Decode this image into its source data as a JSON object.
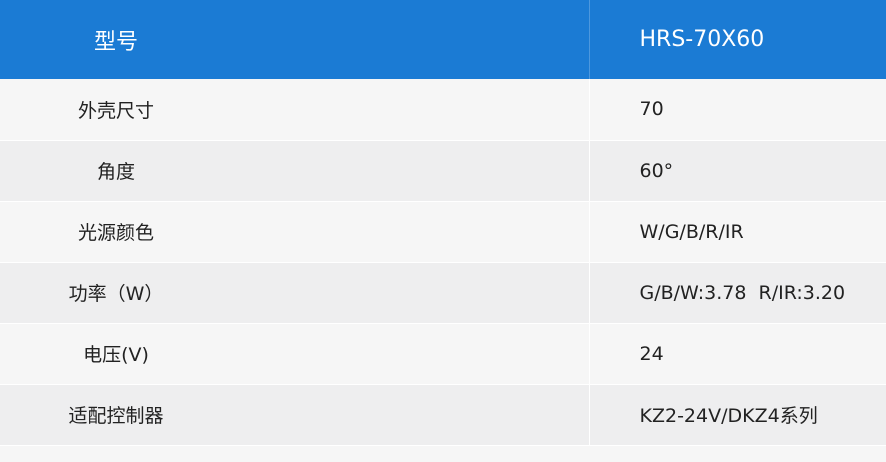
{
  "header": {
    "model_label": "型号",
    "model_value": "HRS-70X60"
  },
  "rows": [
    {
      "label": "外壳尺寸",
      "value": "70"
    },
    {
      "label": "角度",
      "value": "60°"
    },
    {
      "label": "光源颜色",
      "value": "W/G/B/R/IR"
    },
    {
      "label": "功率（W）",
      "value": "G/B/W:3.78  R/IR:3.20"
    },
    {
      "label": "电压(V)",
      "value": "24"
    },
    {
      "label": "适配控制器",
      "value": "KZ2-24V/DKZ4系列"
    }
  ],
  "colors": {
    "header_bg": "#1b7bd4",
    "row_light": "#f6f6f6",
    "row_dark": "#eeeeef"
  }
}
